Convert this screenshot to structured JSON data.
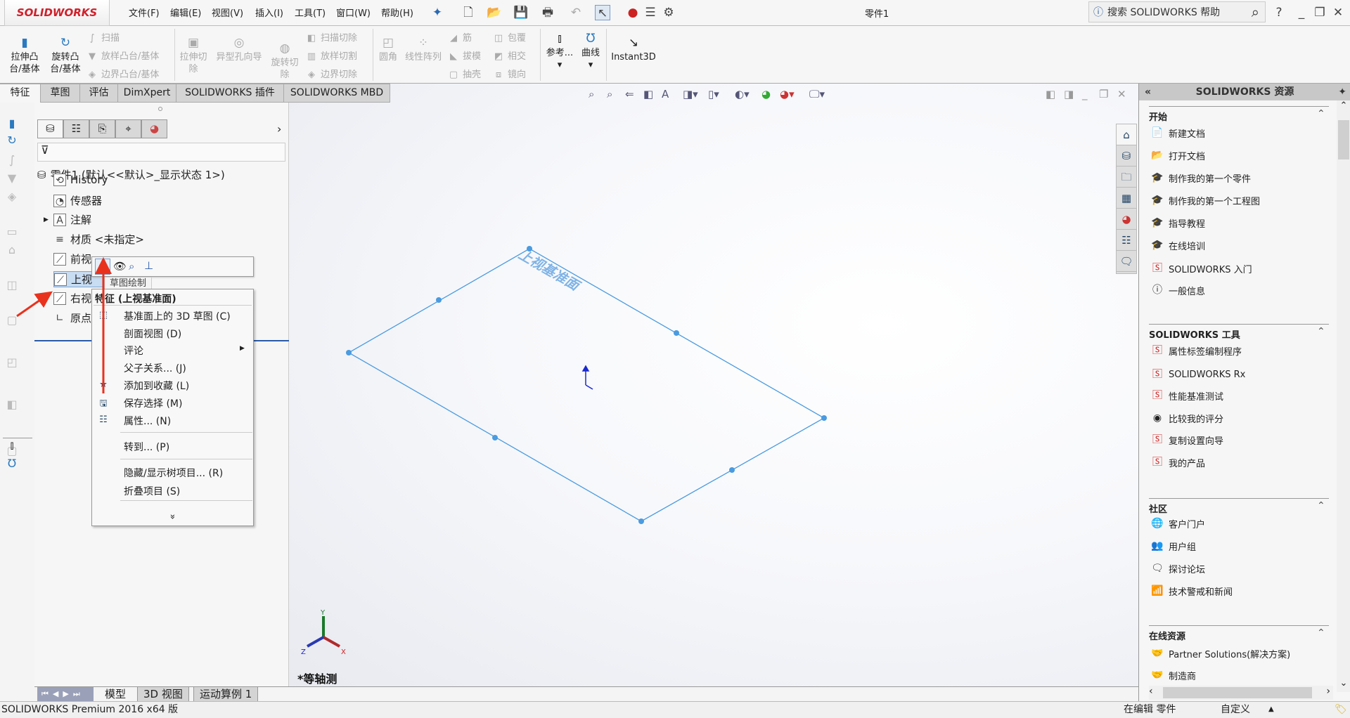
{
  "app": {
    "logo": "SOLIDWORKS",
    "title": "零件1"
  },
  "menu": [
    "文件(F)",
    "编辑(E)",
    "视图(V)",
    "插入(I)",
    "工具(T)",
    "窗口(W)",
    "帮助(H)"
  ],
  "search": {
    "placeholder": "搜索 SOLIDWORKS 帮助"
  },
  "ribbon": {
    "extrude": "拉伸凸台/基体",
    "revolve": "旋转凸台/基体",
    "sweep": "扫描",
    "loft": "放样凸台/基体",
    "boundary": "边界凸台/基体",
    "extrude_cut": "拉伸切除",
    "hole": "异型孔向导",
    "revolve_cut": "旋转切除",
    "sweep_cut": "扫描切除",
    "loft_cut": "放样切割",
    "boundary_cut": "边界切除",
    "fillet": "圆角",
    "pattern": "线性阵列",
    "rib": "筋",
    "draft": "拔模",
    "shell": "抽壳",
    "wrap": "包覆",
    "intersect": "相交",
    "mirror": "镜向",
    "ref": "参考...",
    "curves": "曲线",
    "instant3d": "Instant3D"
  },
  "tabs": [
    "特征",
    "草图",
    "评估",
    "DimXpert",
    "SOLIDWORKS 插件",
    "SOLIDWORKS MBD"
  ],
  "tree": {
    "root": "零件1  (默认<<默认>_显示状态 1>)",
    "items": [
      "History",
      "传感器",
      "注解",
      "材质 <未指定>",
      "前视",
      "上视",
      "右视",
      "原点"
    ]
  },
  "mini_toolbar": {
    "tooltip": "草图绘制"
  },
  "context_menu": {
    "title": "特征 (上视基准面)",
    "items": [
      "基准面上的 3D 草图 (C)",
      "剖面视图 (D)",
      "评论",
      "父子关系... (J)",
      "添加到收藏 (L)",
      "保存选择 (M)",
      "属性... (N)",
      "转到... (P)",
      "隐藏/显示树项目... (R)",
      "折叠项目 (S)"
    ],
    "more": "»"
  },
  "viewport": {
    "plane_label": "上视基准面",
    "view_name": "*等轴测",
    "axes": [
      "X",
      "Y",
      "Z"
    ]
  },
  "task_pane": {
    "title": "SOLIDWORKS 资源",
    "sections": [
      {
        "title": "开始",
        "items": [
          "新建文档",
          "打开文档",
          "制作我的第一个零件",
          "制作我的第一个工程图",
          "指导教程",
          "在线培训",
          "SOLIDWORKS 入门",
          "一般信息"
        ]
      },
      {
        "title": "SOLIDWORKS 工具",
        "items": [
          "属性标签编制程序",
          "SOLIDWORKS Rx",
          "性能基准测试",
          "比较我的评分",
          "复制设置向导",
          "我的产品"
        ]
      },
      {
        "title": "社区",
        "items": [
          "客户门户",
          "用户组",
          "探讨论坛",
          "技术警戒和新闻"
        ]
      },
      {
        "title": "在线资源",
        "items": [
          "Partner Solutions(解决方案)",
          "制造商"
        ]
      }
    ]
  },
  "bottom_tabs": [
    "模型",
    "3D 视图",
    "运动算例 1"
  ],
  "status": {
    "left": "SOLIDWORKS Premium 2016 x64 版",
    "mode": "在编辑 零件",
    "custom": "自定义"
  },
  "colors": {
    "plane": "#4a9be0",
    "accent": "#d0202a",
    "arrow": "#e8321e"
  }
}
